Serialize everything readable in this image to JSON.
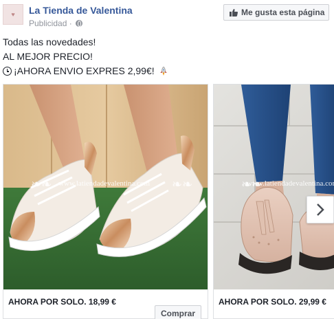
{
  "page": {
    "name": "La Tienda de Valentina",
    "sponsored_label": "Publicidad · "
  },
  "like_button": {
    "label": "Me gusta esta página"
  },
  "post": {
    "line1": "Todas las novedades!",
    "line2": "AL MEJOR PRECIO!",
    "line3": "¡AHORA ENVIO EXPRES 2,99€!"
  },
  "carousel": {
    "cards": [
      {
        "caption": "AHORA POR SOLO. 18,99 €",
        "watermark": "www.latiendadevalentina.com",
        "button_label": "Comprar"
      },
      {
        "caption": "AHORA POR SOLO. 29,99 €",
        "watermark": "www.latiendadevalentina.com"
      }
    ]
  },
  "icons": {
    "globe": "globe-icon",
    "thumb": "thumbs-up-icon",
    "clock": "clock-icon",
    "rocket": "rocket-icon",
    "next": "chevron-right-icon"
  },
  "colors": {
    "link_blue": "#365899",
    "muted_grey": "#90949c",
    "button_bg": "#f6f7f9"
  }
}
